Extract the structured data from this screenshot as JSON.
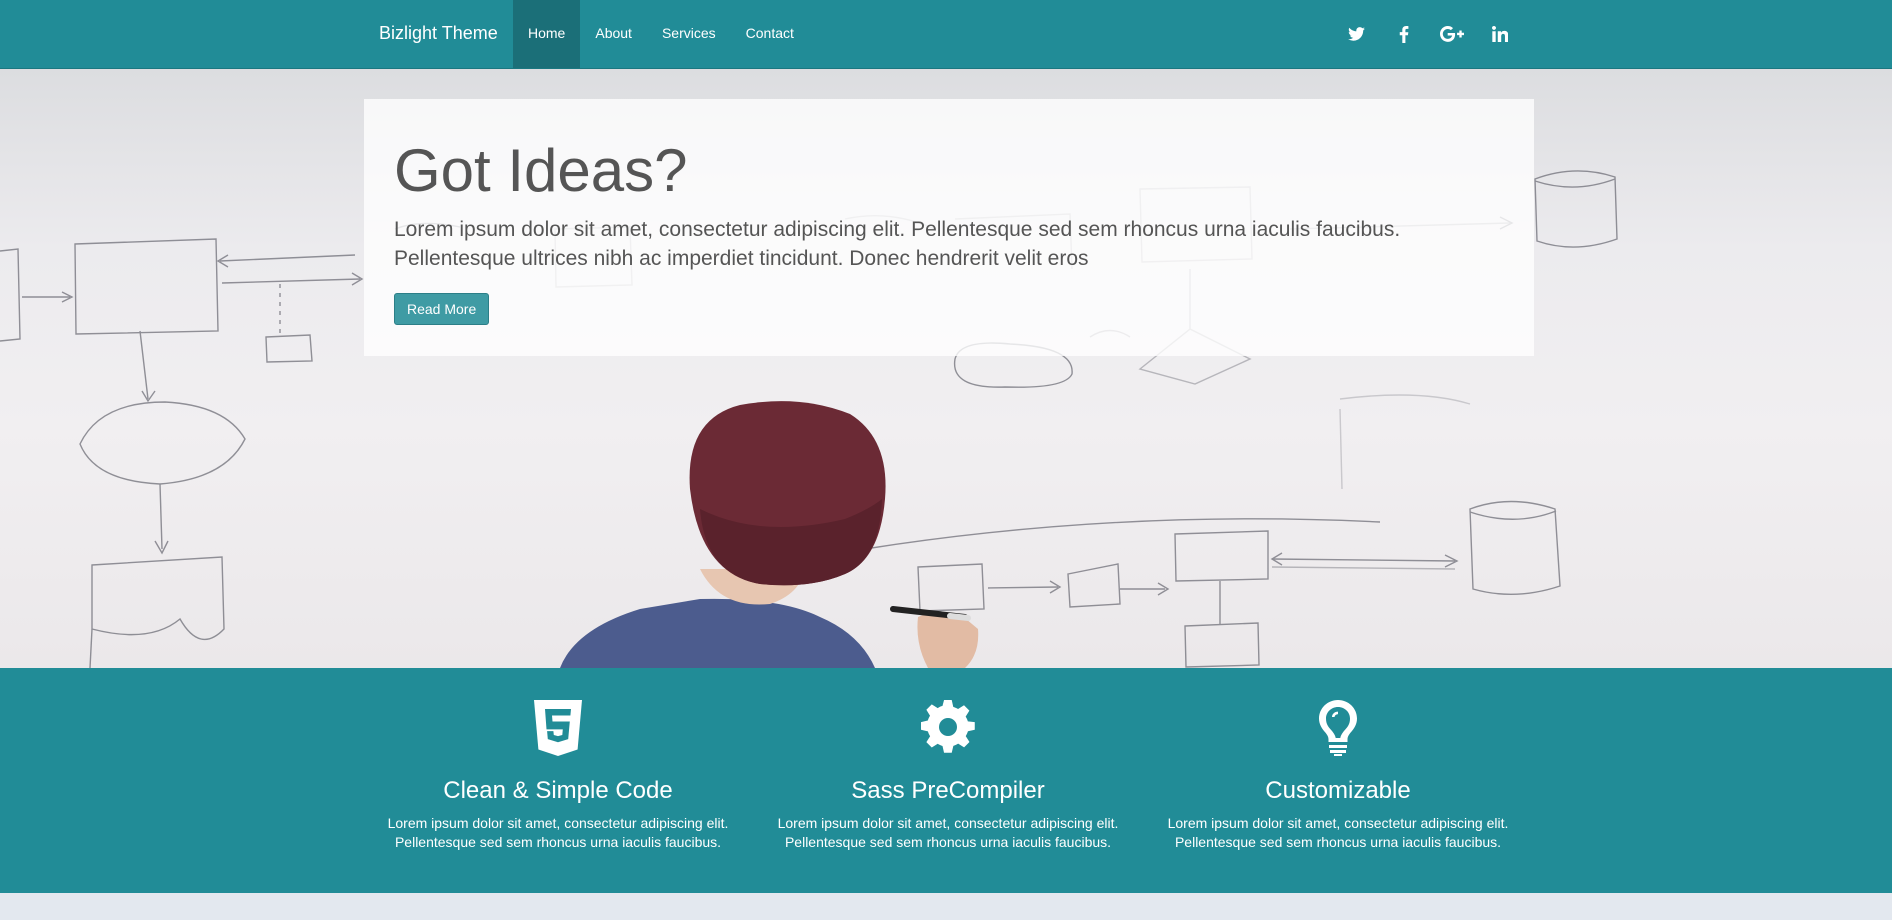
{
  "navbar": {
    "brand": "Bizlight Theme",
    "items": [
      {
        "label": "Home",
        "active": true
      },
      {
        "label": "About",
        "active": false
      },
      {
        "label": "Services",
        "active": false
      },
      {
        "label": "Contact",
        "active": false
      }
    ],
    "social": [
      "twitter-icon",
      "facebook-icon",
      "google-plus-icon",
      "linkedin-icon"
    ]
  },
  "hero": {
    "title": "Got Ideas?",
    "text": "Lorem ipsum dolor sit amet, consectetur adipiscing elit. Pellentesque sed sem rhoncus urna iaculis faucibus. Pellentesque ultrices nibh ac imperdiet tincidunt. Donec hendrerit velit eros",
    "button": "Read More"
  },
  "features": [
    {
      "icon": "html5-icon",
      "title": "Clean & Simple Code",
      "text": "Lorem ipsum dolor sit amet, consectetur adipiscing elit. Pellentesque sed sem rhoncus urna iaculis faucibus."
    },
    {
      "icon": "gear-icon",
      "title": "Sass PreCompiler",
      "text": "Lorem ipsum dolor sit amet, consectetur adipiscing elit. Pellentesque sed sem rhoncus urna iaculis faucibus."
    },
    {
      "icon": "lightbulb-icon",
      "title": "Customizable",
      "text": "Lorem ipsum dolor sit amet, consectetur adipiscing elit. Pellentesque sed sem rhoncus urna iaculis faucibus."
    }
  ],
  "colors": {
    "primary": "#218c97",
    "active_nav": "#1b6f78",
    "button": "#3f9ba4",
    "footer_bg": "#e3e8ef"
  }
}
